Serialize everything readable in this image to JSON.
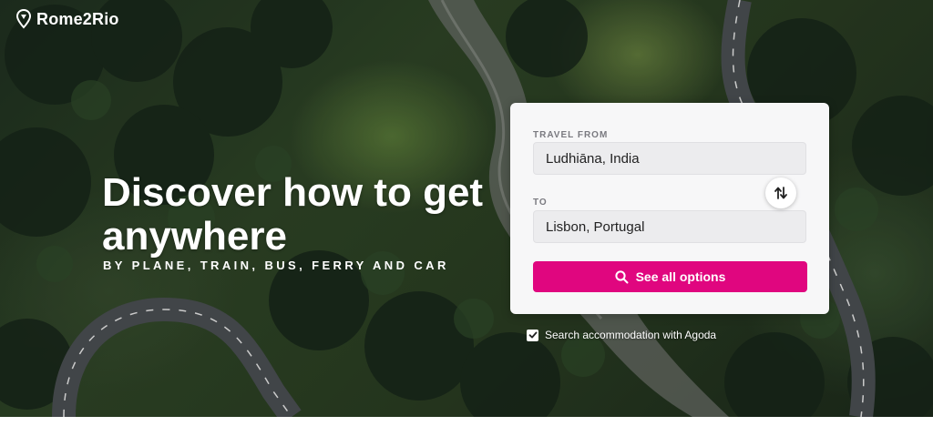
{
  "brand": {
    "name": "Rome2Rio"
  },
  "hero": {
    "headline": "Discover how to get anywhere",
    "subheadline": "BY PLANE, TRAIN, BUS, FERRY AND CAR"
  },
  "search": {
    "from_label": "TRAVEL FROM",
    "from_value": "Ludhiāna, India",
    "to_label": "TO",
    "to_value": "Lisbon, Portugal",
    "swap_icon": "swap-vertical-icon",
    "submit_label": "See all options",
    "submit_icon": "search-icon"
  },
  "accommodation": {
    "checked": true,
    "label": "Search accommodation with Agoda"
  },
  "colors": {
    "accent": "#e0067f",
    "card_bg": "#f7f7f8",
    "field_bg": "#ececee"
  }
}
